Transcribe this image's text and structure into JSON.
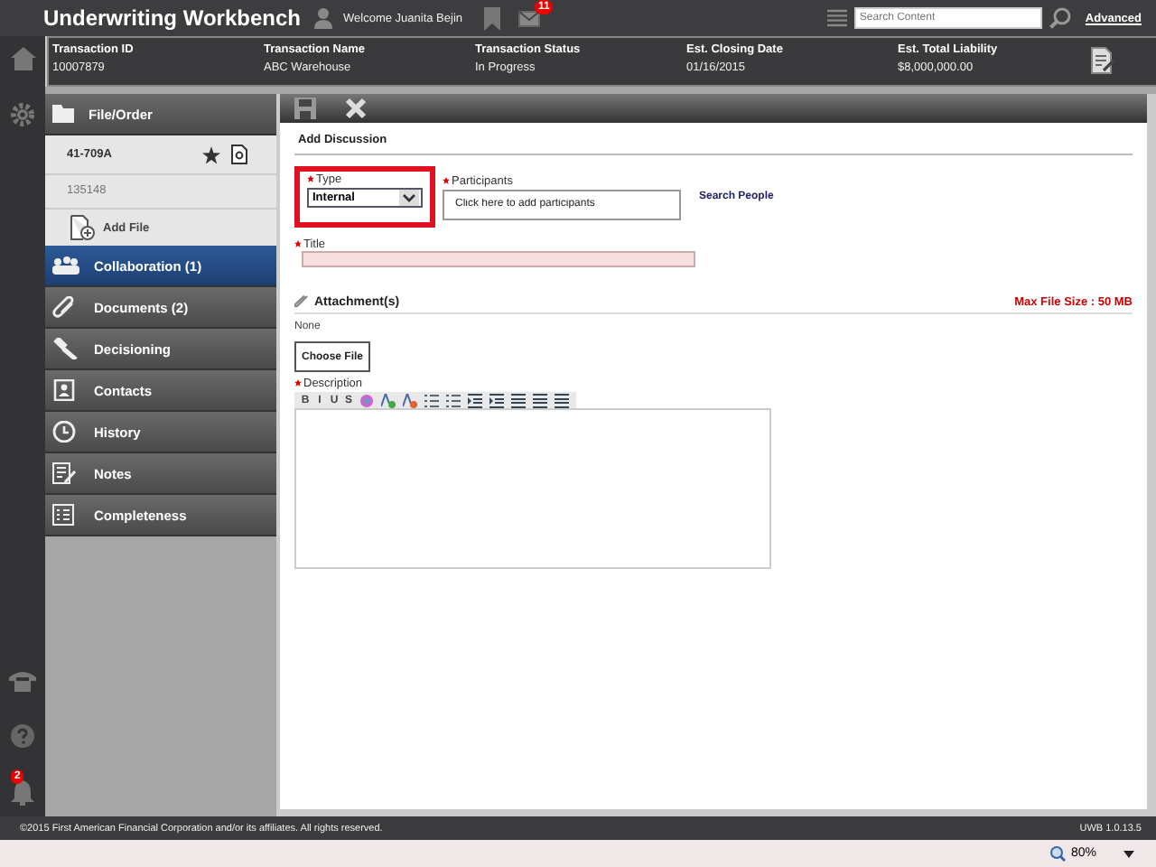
{
  "app_title": "Underwriting Workbench",
  "header": {
    "welcome": "Welcome Juanita Bejin",
    "mail_badge": "11",
    "search": {
      "placeholder": "Search Content"
    },
    "advanced_link": "Advanced"
  },
  "transaction": [
    {
      "label": "Transaction ID",
      "value": "10007879"
    },
    {
      "label": "Transaction Name",
      "value": "ABC Warehouse"
    },
    {
      "label": "Transaction Status",
      "value": "In Progress"
    },
    {
      "label": "Est. Closing Date",
      "value": "01/16/2015"
    },
    {
      "label": "Est. Total Liability",
      "value": "$8,000,000.00"
    }
  ],
  "rail": {
    "bell_badge": "2"
  },
  "sidebar": {
    "header": "File/Order",
    "file_number": "41-709A",
    "file_sub": "135148",
    "add_file": "Add File",
    "items": [
      {
        "label": "Collaboration (1)",
        "selected": true
      },
      {
        "label": "Documents (2)",
        "selected": false
      },
      {
        "label": "Decisioning",
        "selected": false
      },
      {
        "label": "Contacts",
        "selected": false
      },
      {
        "label": "History",
        "selected": false
      },
      {
        "label": "Notes",
        "selected": false
      },
      {
        "label": "Completeness",
        "selected": false
      }
    ]
  },
  "form": {
    "section_title": "Add Discussion",
    "type": {
      "label": "Type",
      "value": "Internal",
      "required": true,
      "highlighted": true
    },
    "participants": {
      "label": "Participants",
      "placeholder": "Click here to add participants",
      "required": true
    },
    "search_people": "Search People",
    "title": {
      "label": "Title",
      "required": true
    },
    "attachments": {
      "label": "Attachment(s)",
      "max_size": "Max File Size : 50 MB",
      "status": "None",
      "choose_button": "Choose File"
    },
    "description": {
      "label": "Description",
      "required": true,
      "toolbar": [
        {
          "kind": "text",
          "label": "B"
        },
        {
          "kind": "text",
          "label": "I"
        },
        {
          "kind": "text",
          "label": "U"
        },
        {
          "kind": "text",
          "label": "S"
        },
        {
          "kind": "color"
        },
        {
          "kind": "grow"
        },
        {
          "kind": "shrink"
        },
        {
          "kind": "list"
        },
        {
          "kind": "list"
        },
        {
          "kind": "indent"
        },
        {
          "kind": "indent"
        },
        {
          "kind": "align"
        },
        {
          "kind": "align"
        },
        {
          "kind": "align"
        }
      ]
    }
  },
  "footer": {
    "copyright": "©2015 First American Financial Corporation and/or its affiliates. All rights reserved.",
    "version": "UWB 1.0.13.5"
  },
  "status_bar": {
    "zoom": "80%"
  }
}
